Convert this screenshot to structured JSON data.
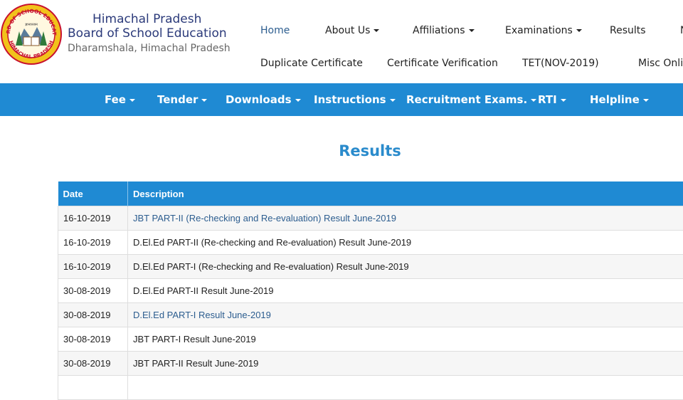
{
  "header": {
    "logo": {
      "ring_text_top": "BOARD OF SCHOOL EDUCATION",
      "ring_text_bottom": "HIMACHAL PRADESH",
      "emblem_text": "ज्ञानाञ्जन"
    },
    "brand_line1": "Himachal Pradesh",
    "brand_line2": "Board of School Education",
    "brand_line3": "Dharamshala, Himachal Pradesh"
  },
  "topnav_row1": [
    {
      "label": "Home",
      "dropdown": false,
      "active": true
    },
    {
      "label": "About Us",
      "dropdown": true
    },
    {
      "label": "Affiliations",
      "dropdown": true
    },
    {
      "label": "Examinations",
      "dropdown": true
    },
    {
      "label": "Results",
      "dropdown": false
    },
    {
      "label": "N",
      "dropdown": false
    }
  ],
  "topnav_row2": [
    {
      "label": "Duplicate Certificate"
    },
    {
      "label": "Certificate Verification"
    },
    {
      "label": "TET(NOV-2019)"
    },
    {
      "label": "Misc Onlin"
    }
  ],
  "bluenav": [
    {
      "label": "Fee"
    },
    {
      "label": "Tender"
    },
    {
      "label": "Downloads"
    },
    {
      "label": "Instructions"
    },
    {
      "label": "Recruitment Exams."
    },
    {
      "label": "RTI"
    },
    {
      "label": "Helpline"
    }
  ],
  "page_title": "Results",
  "table": {
    "headers": [
      "Date",
      "Description"
    ],
    "rows": [
      {
        "date": "16-10-2019",
        "description": "JBT PART-II (Re-checking and Re-evaluation) Result June-2019",
        "link": true
      },
      {
        "date": "16-10-2019",
        "description": "D.El.Ed PART-II (Re-checking and Re-evaluation) Result June-2019",
        "link": false
      },
      {
        "date": "16-10-2019",
        "description": "D.El.Ed PART-I (Re-checking and Re-evaluation) Result June-2019",
        "link": false
      },
      {
        "date": "30-08-2019",
        "description": "D.El.Ed PART-II Result June-2019",
        "link": false
      },
      {
        "date": "30-08-2019",
        "description": "D.El.Ed PART-I Result June-2019",
        "link": true
      },
      {
        "date": "30-08-2019",
        "description": "JBT PART-I Result June-2019",
        "link": false
      },
      {
        "date": "30-08-2019",
        "description": "JBT PART-II Result  June-2019",
        "link": false
      }
    ]
  },
  "colors": {
    "primary_blue": "#1f8ad3",
    "title_blue": "#2a8bcc",
    "link_blue": "#2c5d8f",
    "brand_navy": "#2b3a7a"
  }
}
